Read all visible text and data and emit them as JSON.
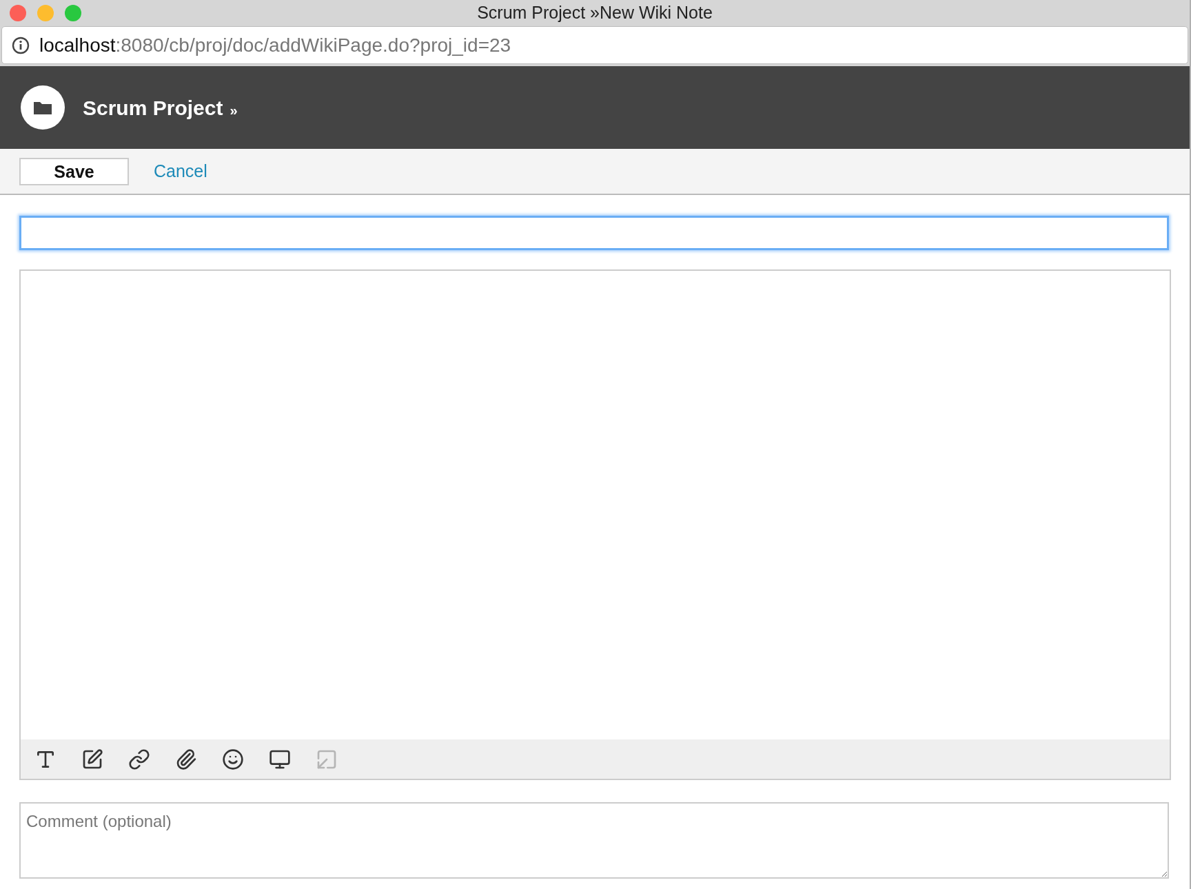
{
  "window": {
    "title": "Scrum Project »New Wiki Note"
  },
  "address_bar": {
    "host": "localhost",
    "path": ":8080/cb/proj/doc/addWikiPage.do?proj_id=23"
  },
  "header": {
    "title": "Scrum Project",
    "separator": "»"
  },
  "actions": [
    {
      "kind": "button",
      "label": "Save"
    },
    {
      "kind": "link",
      "label": "Cancel"
    }
  ],
  "title_field": {
    "focused": true
  },
  "editor_toolbar": [
    {
      "kind": "format",
      "disabled": false
    },
    {
      "kind": "image",
      "disabled": false
    },
    {
      "kind": "link",
      "disabled": false
    },
    {
      "kind": "attach",
      "disabled": false
    },
    {
      "kind": "emoji",
      "disabled": false
    },
    {
      "kind": "screen",
      "disabled": false
    },
    {
      "kind": "resize",
      "disabled": true
    }
  ],
  "comment": {
    "placeholder": "Comment (optional)"
  }
}
